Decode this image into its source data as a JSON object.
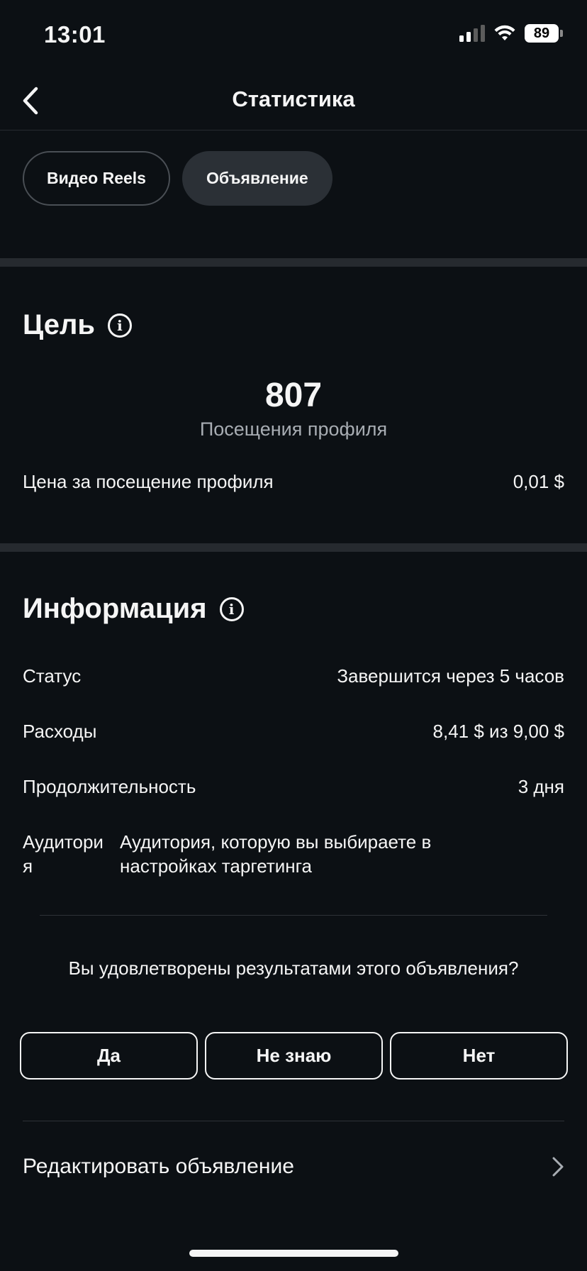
{
  "status_bar": {
    "time": "13:01",
    "battery": "89"
  },
  "header": {
    "title": "Статистика"
  },
  "tabs": [
    {
      "label": "Видео Reels",
      "active": false
    },
    {
      "label": "Объявление",
      "active": true
    }
  ],
  "goal": {
    "title": "Цель",
    "metric_value": "807",
    "metric_label": "Посещения профиля",
    "cost_label": "Цена за посещение профиля",
    "cost_value": "0,01 $"
  },
  "info": {
    "title": "Информация",
    "rows": [
      {
        "label": "Статус",
        "value": "Завершится через 5 часов"
      },
      {
        "label": "Расходы",
        "value": "8,41 $ из 9,00 $"
      },
      {
        "label": "Продолжительность",
        "value": "3 дня"
      }
    ],
    "audience_label": "Аудитория",
    "audience_value": "Аудитория, которую вы выбираете в настройках таргетинга"
  },
  "feedback": {
    "question": "Вы удовлетворены результатами этого объявления?",
    "yes": "Да",
    "unsure": "Не знаю",
    "no": "Нет"
  },
  "edit": {
    "label": "Редактировать объявление"
  },
  "colors": {
    "background": "#0c1014",
    "separator": "#262a2f",
    "text": "#f5f5f5",
    "muted": "#a8adb3"
  }
}
